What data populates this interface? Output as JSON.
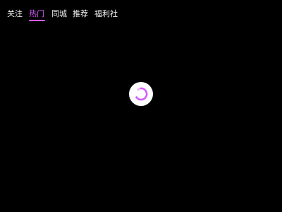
{
  "tabs": [
    {
      "label": "关注",
      "active": false
    },
    {
      "label": "热门",
      "active": true
    },
    {
      "label": "同城",
      "active": false
    },
    {
      "label": "推荐",
      "active": false
    },
    {
      "label": "福利社",
      "active": false
    }
  ],
  "colors": {
    "background": "#000000",
    "tab_text": "#f2f2f2",
    "accent": "#d65cff",
    "spinner_bg": "#ffffff"
  },
  "loading": {
    "icon": "spinner-icon"
  }
}
